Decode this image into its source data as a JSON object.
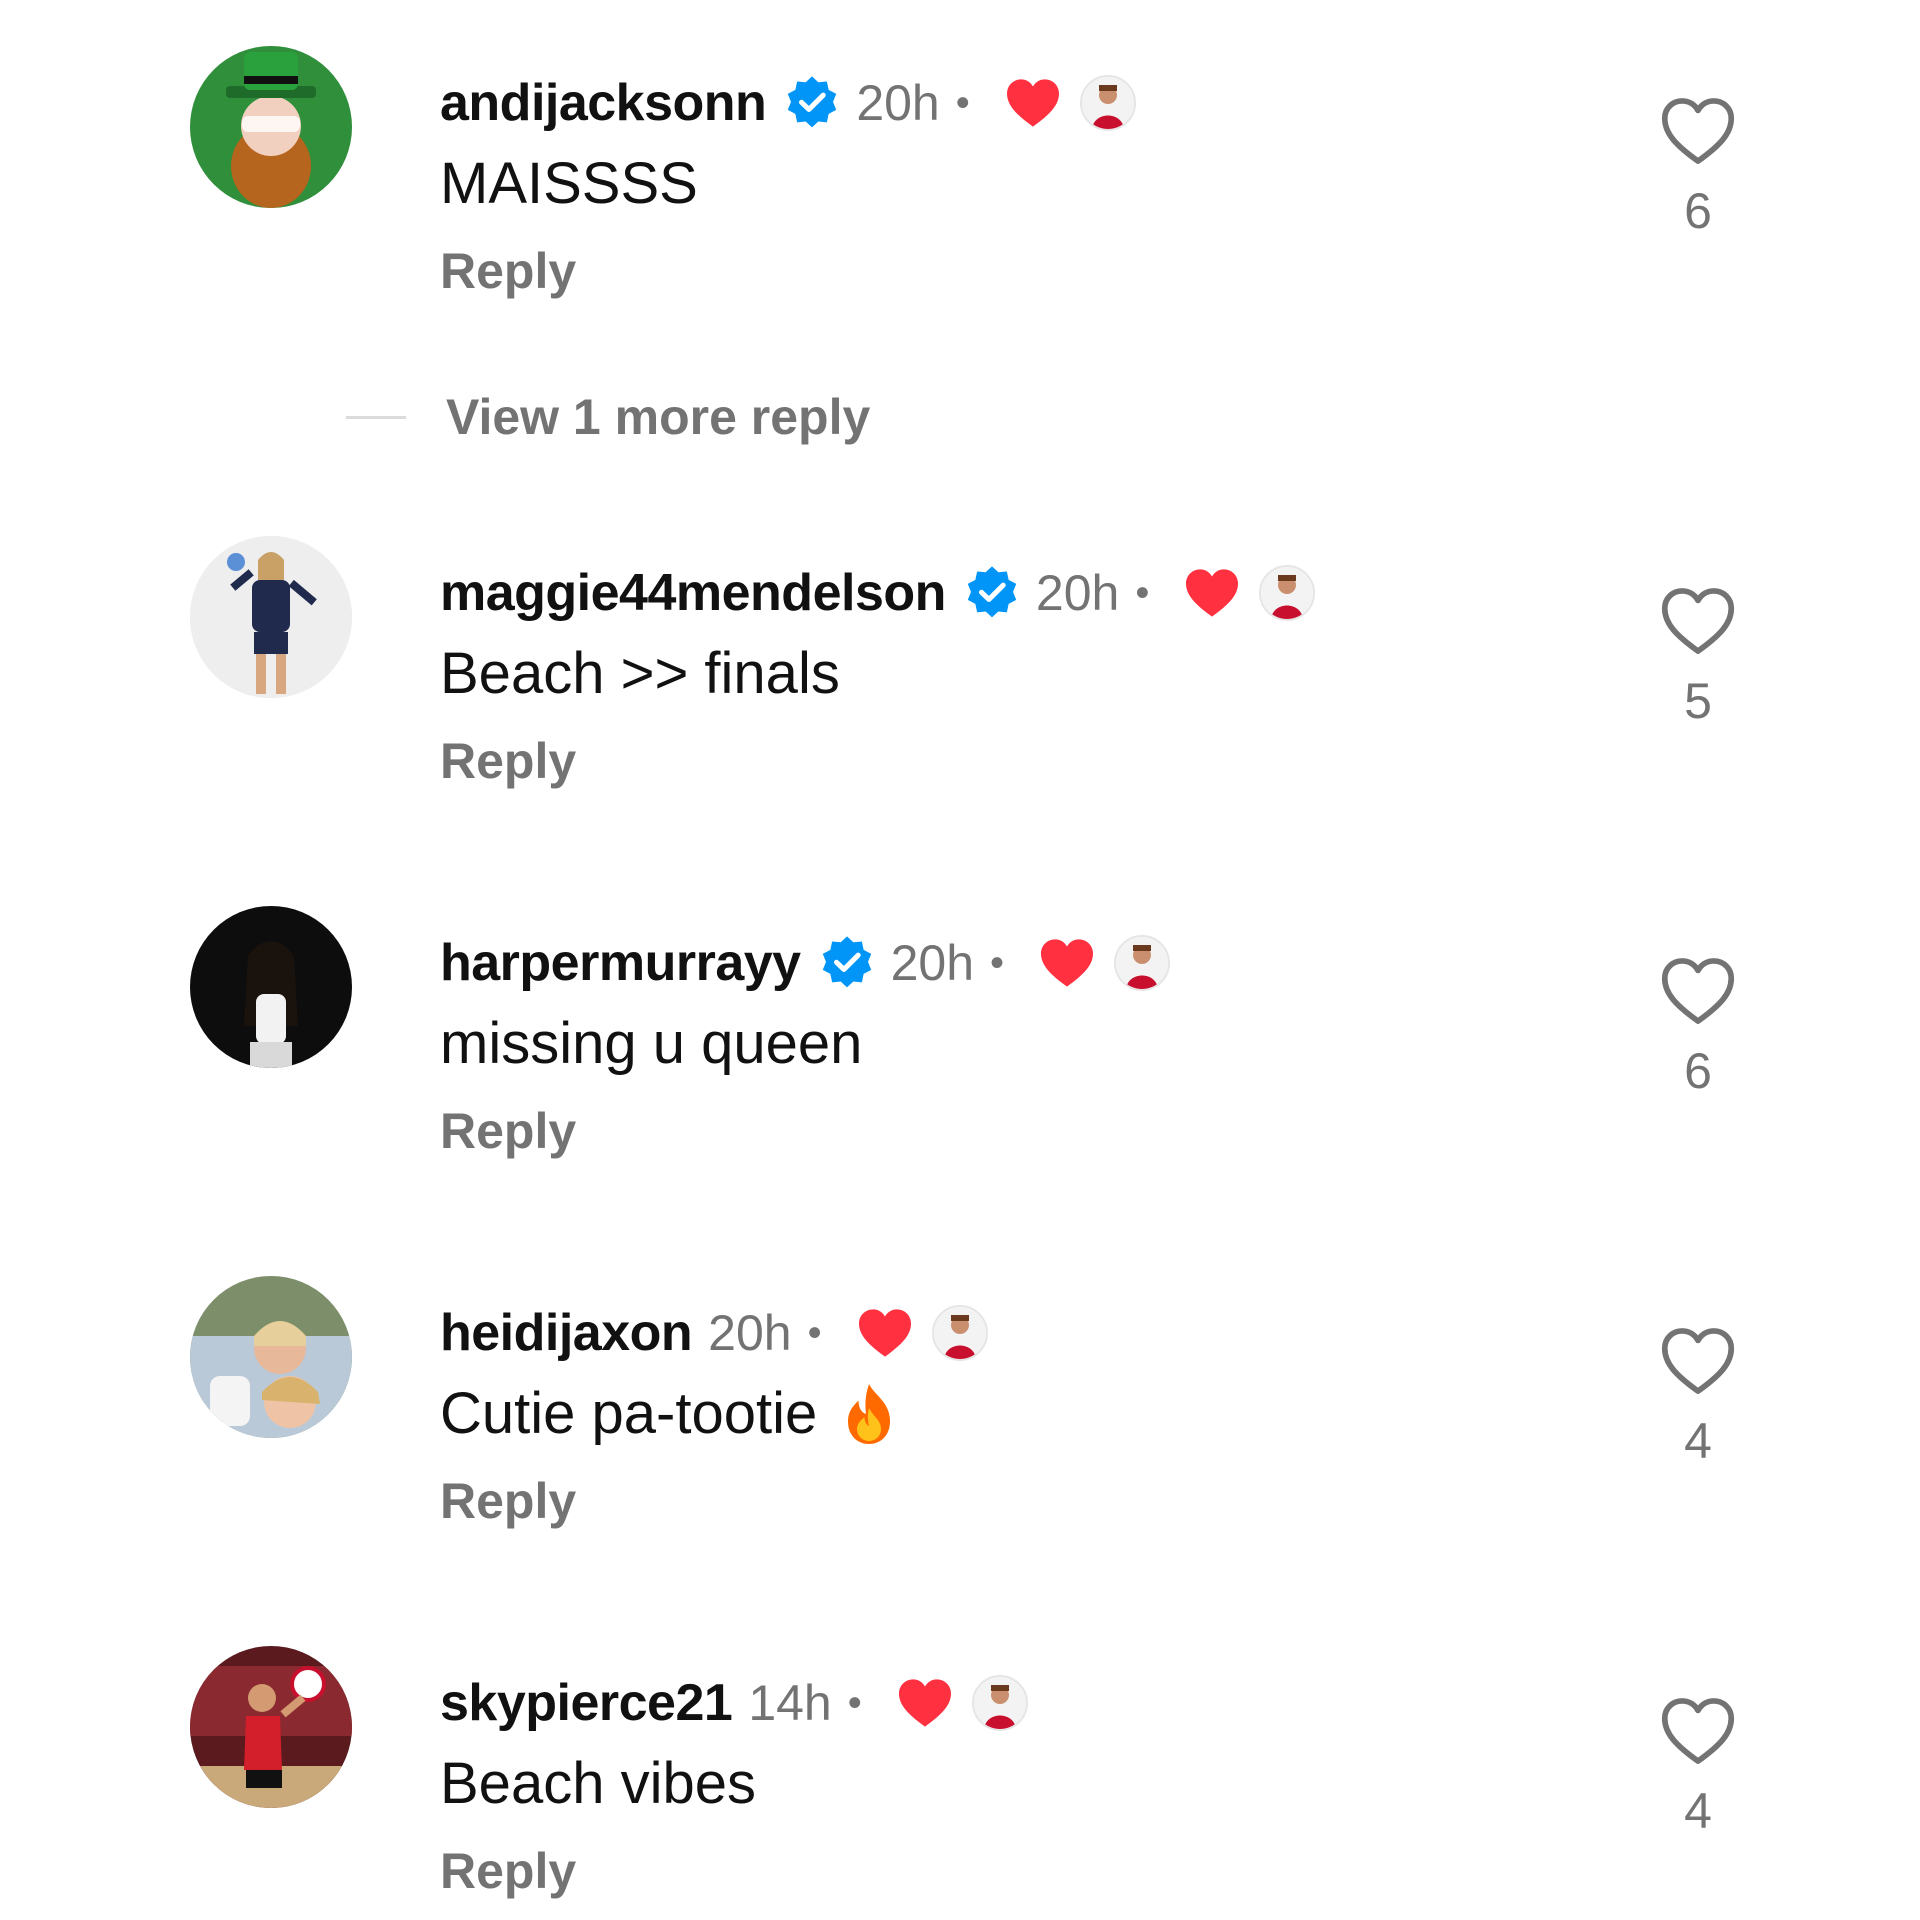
{
  "comments": [
    {
      "username": "andijacksonn",
      "verified": true,
      "time": "20h",
      "separator": "•",
      "text": "MAISSSS",
      "reply_label": "Reply",
      "like_count": "6",
      "avatar_icon": "leprechaun-avatar",
      "liked_by_author": true
    },
    {
      "username": "maggie44mendelson",
      "verified": true,
      "time": "20h",
      "separator": "•",
      "text": "Beach >> finals",
      "reply_label": "Reply",
      "like_count": "5",
      "avatar_icon": "volleyball-player-avatar",
      "liked_by_author": true
    },
    {
      "username": "harpermurrayy",
      "verified": true,
      "time": "20h",
      "separator": "•",
      "text": "missing u queen",
      "reply_label": "Reply",
      "like_count": "6",
      "avatar_icon": "night-photo-avatar",
      "liked_by_author": true
    },
    {
      "username": "heidijaxon",
      "verified": false,
      "time": "20h",
      "separator": "•",
      "text": "Cutie pa-tootie",
      "emoji": "fire",
      "reply_label": "Reply",
      "like_count": "4",
      "avatar_icon": "selfie-avatar",
      "liked_by_author": true
    },
    {
      "username": "skypierce21",
      "verified": false,
      "time": "14h",
      "separator": "•",
      "text": "Beach vibes",
      "reply_label": "Reply",
      "like_count": "4",
      "avatar_icon": "court-player-avatar",
      "liked_by_author": true
    }
  ],
  "view_more_replies": "View 1 more reply",
  "colors": {
    "verified": "#0095f6",
    "liked_heart": "#ff3040",
    "secondary_text": "#737373",
    "primary_text": "#111111"
  }
}
